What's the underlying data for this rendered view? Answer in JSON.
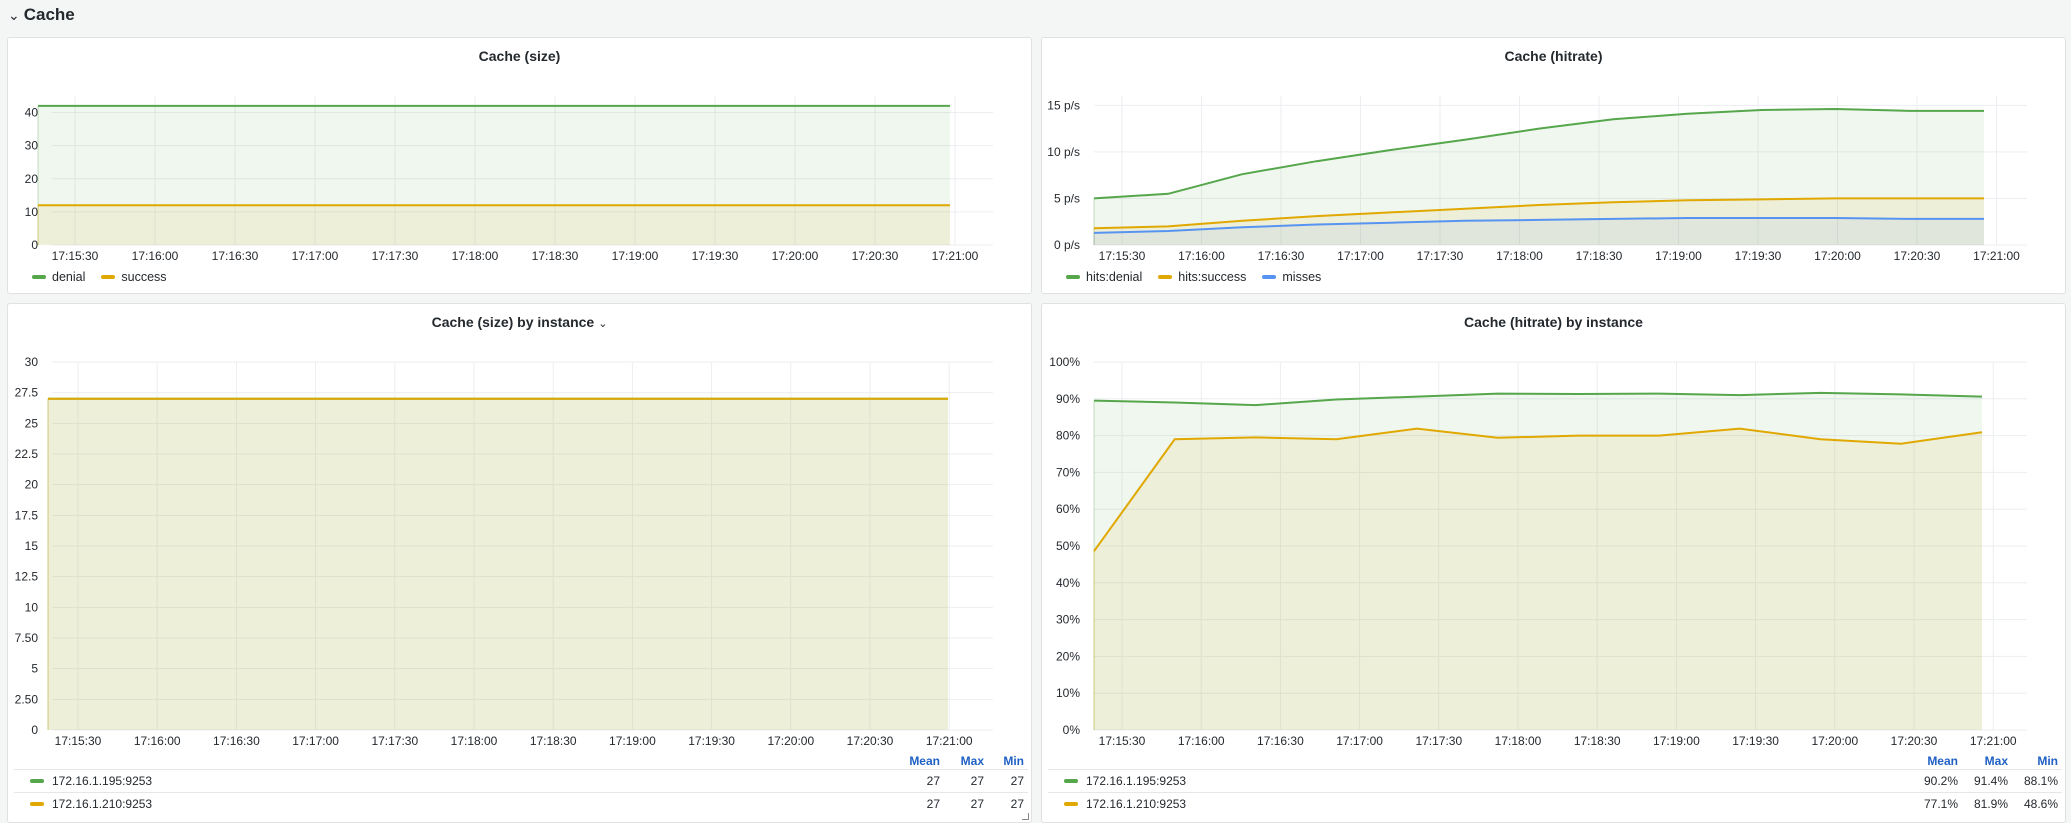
{
  "row": {
    "title": "Cache",
    "chevron": "⌄"
  },
  "colors": {
    "green": "#56a64b",
    "yellow": "#e0a800",
    "blue": "#5794f2"
  },
  "panels": [
    {
      "title": "Cache (size)",
      "legend": [
        {
          "label": "denial",
          "color": "#56a64b"
        },
        {
          "label": "success",
          "color": "#e0a800"
        }
      ]
    },
    {
      "title": "Cache (hitrate)",
      "legend": [
        {
          "label": "hits:denial",
          "color": "#56a64b"
        },
        {
          "label": "hits:success",
          "color": "#e0a800"
        },
        {
          "label": "misses",
          "color": "#5794f2"
        }
      ]
    },
    {
      "title": "Cache (size) by instance",
      "menu_icon": "chevron-down-icon",
      "table": {
        "headers": [
          "Mean",
          "Max",
          "Min"
        ],
        "rows": [
          {
            "name": "172.16.1.195:9253",
            "color": "#56a64b",
            "values": [
              "27",
              "27",
              "27"
            ]
          },
          {
            "name": "172.16.1.210:9253",
            "color": "#e0a800",
            "values": [
              "27",
              "27",
              "27"
            ]
          }
        ]
      }
    },
    {
      "title": "Cache (hitrate) by instance",
      "table": {
        "headers": [
          "Mean",
          "Max",
          "Min"
        ],
        "rows": [
          {
            "name": "172.16.1.195:9253",
            "color": "#56a64b",
            "values": [
              "90.2%",
              "91.4%",
              "88.1%"
            ]
          },
          {
            "name": "172.16.1.210:9253",
            "color": "#e0a800",
            "values": [
              "77.1%",
              "81.9%",
              "48.6%"
            ]
          }
        ]
      }
    }
  ],
  "chart_data": [
    {
      "type": "area",
      "title": "Cache (size)",
      "x": [
        "17:15:30",
        "17:16:00",
        "17:16:30",
        "17:17:00",
        "17:17:30",
        "17:18:00",
        "17:18:30",
        "17:19:00",
        "17:19:30",
        "17:20:00",
        "17:20:30",
        "17:21:00"
      ],
      "ylim": [
        0,
        45
      ],
      "yticks": [
        "0",
        "10",
        "20",
        "30",
        "40"
      ],
      "series": [
        {
          "name": "denial",
          "color": "#56a64b",
          "values": [
            42,
            42,
            42,
            42,
            42,
            42,
            42,
            42,
            42,
            42,
            42,
            42
          ]
        },
        {
          "name": "success",
          "color": "#e0a800",
          "values": [
            12,
            12,
            12,
            12,
            12,
            12,
            12,
            12,
            12,
            12,
            12,
            12
          ]
        }
      ]
    },
    {
      "type": "area",
      "title": "Cache (hitrate)",
      "x": [
        "17:15:30",
        "17:16:00",
        "17:16:30",
        "17:17:00",
        "17:17:30",
        "17:18:00",
        "17:18:30",
        "17:19:00",
        "17:19:30",
        "17:20:00",
        "17:20:30",
        "17:21:00"
      ],
      "ylim": [
        0,
        16
      ],
      "yticks": [
        "0 p/s",
        "5 p/s",
        "10 p/s",
        "15 p/s"
      ],
      "series": [
        {
          "name": "hits:denial",
          "color": "#56a64b",
          "values": [
            5.0,
            5.5,
            7.6,
            9.0,
            10.2,
            11.3,
            12.5,
            13.5,
            14.1,
            14.5,
            14.6,
            14.4,
            14.4
          ]
        },
        {
          "name": "hits:success",
          "color": "#e0a800",
          "values": [
            1.8,
            2.0,
            2.6,
            3.1,
            3.5,
            3.9,
            4.3,
            4.6,
            4.8,
            4.9,
            5.0,
            5.0,
            5.0
          ]
        },
        {
          "name": "misses",
          "color": "#5794f2",
          "values": [
            1.3,
            1.5,
            1.9,
            2.2,
            2.4,
            2.6,
            2.7,
            2.8,
            2.9,
            2.9,
            2.9,
            2.8,
            2.8
          ]
        }
      ]
    },
    {
      "type": "area",
      "title": "Cache (size) by instance",
      "x": [
        "17:15:30",
        "17:16:00",
        "17:16:30",
        "17:17:00",
        "17:17:30",
        "17:18:00",
        "17:18:30",
        "17:19:00",
        "17:19:30",
        "17:20:00",
        "17:20:30",
        "17:21:00"
      ],
      "ylim": [
        0,
        30
      ],
      "yticks": [
        "0",
        "2.50",
        "5",
        "7.50",
        "10",
        "12.5",
        "15",
        "17.5",
        "20",
        "22.5",
        "25",
        "27.5",
        "30"
      ],
      "series": [
        {
          "name": "172.16.1.195:9253",
          "color": "#56a64b",
          "values": [
            27,
            27,
            27,
            27,
            27,
            27,
            27,
            27,
            27,
            27,
            27,
            27
          ]
        },
        {
          "name": "172.16.1.210:9253",
          "color": "#e0a800",
          "values": [
            27,
            27,
            27,
            27,
            27,
            27,
            27,
            27,
            27,
            27,
            27,
            27
          ]
        }
      ]
    },
    {
      "type": "area",
      "title": "Cache (hitrate) by instance",
      "x": [
        "17:15:30",
        "17:16:00",
        "17:16:30",
        "17:17:00",
        "17:17:30",
        "17:18:00",
        "17:18:30",
        "17:19:00",
        "17:19:30",
        "17:20:00",
        "17:20:30",
        "17:21:00"
      ],
      "ylim": [
        0,
        100
      ],
      "yticks": [
        "0%",
        "10%",
        "20%",
        "30%",
        "40%",
        "50%",
        "60%",
        "70%",
        "80%",
        "90%",
        "100%"
      ],
      "series": [
        {
          "name": "172.16.1.195:9253",
          "color": "#56a64b",
          "values": [
            89.5,
            89.0,
            88.3,
            89.8,
            90.6,
            91.4,
            91.3,
            91.4,
            91.0,
            91.6,
            91.2,
            90.6
          ]
        },
        {
          "name": "172.16.1.210:9253",
          "color": "#e0a800",
          "values": [
            48.6,
            79.0,
            79.5,
            79.0,
            81.9,
            79.4,
            80.0,
            80.0,
            81.9,
            79.0,
            77.8,
            80.9
          ]
        }
      ]
    }
  ]
}
